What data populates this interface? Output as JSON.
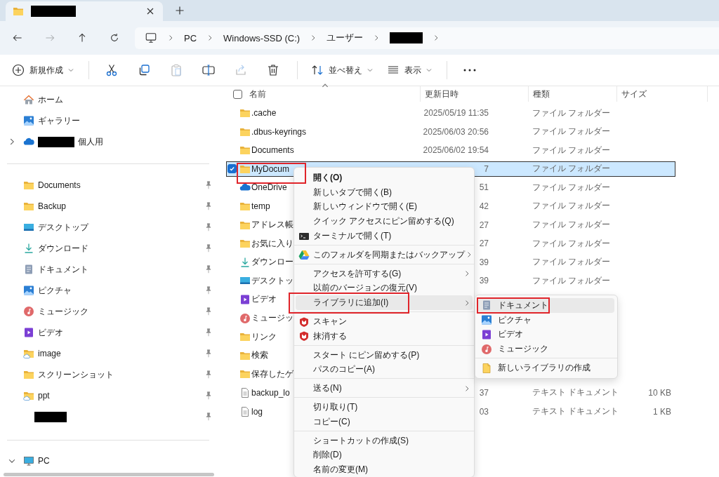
{
  "tabs": [
    {
      "redacted": true,
      "selected": true
    }
  ],
  "nav": [
    {
      "kind": "back",
      "disabled": false
    },
    {
      "kind": "forward",
      "disabled": true
    },
    {
      "kind": "up",
      "disabled": false
    },
    {
      "kind": "refresh",
      "disabled": false
    }
  ],
  "breadcrumb": [
    {
      "label": "PC"
    },
    {
      "label": "Windows-SSD (C:)"
    },
    {
      "label": "ユーザー"
    },
    {
      "redacted": true
    }
  ],
  "toolbar": [
    {
      "kind": "new",
      "label": "新規作成",
      "dropdown": true,
      "disabled": false
    },
    {
      "kind": "divider"
    },
    {
      "kind": "cut",
      "disabled": false
    },
    {
      "kind": "copy",
      "disabled": false
    },
    {
      "kind": "paste",
      "disabled": true
    },
    {
      "kind": "rename",
      "disabled": false
    },
    {
      "kind": "share",
      "disabled": true
    },
    {
      "kind": "delete",
      "disabled": false
    },
    {
      "kind": "divider"
    },
    {
      "kind": "sort",
      "label": "並べ替え",
      "dropdown": true,
      "disabled": false
    },
    {
      "kind": "view",
      "label": "表示",
      "dropdown": true,
      "disabled": false
    },
    {
      "kind": "divider"
    },
    {
      "kind": "more",
      "disabled": false
    }
  ],
  "sidebar": {
    "sections": [
      {
        "items": [
          {
            "kind": "home",
            "label": "ホーム"
          },
          {
            "kind": "gallery",
            "label": "ギャラリー"
          },
          {
            "kind": "cloud",
            "label": "個人用",
            "redacted_prefix": true,
            "expanded": false
          }
        ]
      },
      {
        "items": [
          {
            "kind": "folder",
            "label": "Documents",
            "pinned": true
          },
          {
            "kind": "folder",
            "label": "Backup",
            "pinned": true
          },
          {
            "kind": "desktop",
            "label": "デスクトップ",
            "pinned": true
          },
          {
            "kind": "download",
            "label": "ダウンロード",
            "pinned": true
          },
          {
            "kind": "documents",
            "label": "ドキュメント",
            "pinned": true
          },
          {
            "kind": "pictures",
            "label": "ピクチャ",
            "pinned": true
          },
          {
            "kind": "music",
            "label": "ミュージック",
            "pinned": true
          },
          {
            "kind": "video",
            "label": "ビデオ",
            "pinned": true
          },
          {
            "kind": "cloudfolder",
            "label": "image",
            "pinned": true
          },
          {
            "kind": "folder",
            "label": "スクリーンショット",
            "pinned": true
          },
          {
            "kind": "cloudfolder",
            "label": "ppt",
            "pinned": true
          },
          {
            "kind": "redacted",
            "pinned": true
          }
        ]
      },
      {
        "items": [
          {
            "kind": "pc",
            "label": "PC",
            "expanded": true
          }
        ]
      }
    ]
  },
  "list": {
    "select_all": {
      "checked": false
    },
    "columns": [
      {
        "label": "名前",
        "sorted": true
      },
      {
        "label": "更新日時"
      },
      {
        "label": "種類"
      },
      {
        "label": "サイズ"
      }
    ],
    "rows": [
      {
        "kind": "folder",
        "name": ".cache",
        "modified": "2025/05/19 11:35",
        "type": "ファイル フォルダー",
        "selected": false
      },
      {
        "kind": "folder",
        "name": ".dbus-keyrings",
        "modified": "2025/06/03 20:56",
        "type": "ファイル フォルダー",
        "selected": false
      },
      {
        "kind": "folder",
        "name": "Documents",
        "modified": "2025/06/02 19:54",
        "type": "ファイル フォルダー",
        "selected": false
      },
      {
        "kind": "folder",
        "name": "MyDocum",
        "modified": "7",
        "type": "ファイル フォルダー",
        "selected": true,
        "outlined": true
      },
      {
        "kind": "cloud",
        "name": "OneDrive",
        "modified": "51",
        "type": "ファイル フォルダー",
        "selected": false
      },
      {
        "kind": "folder",
        "name": "temp",
        "modified": "42",
        "type": "ファイル フォルダー",
        "selected": false
      },
      {
        "kind": "folder",
        "name": "アドレス帳",
        "modified": "27",
        "type": "ファイル フォルダー",
        "selected": false
      },
      {
        "kind": "folder",
        "name": "お気に入り",
        "modified": "27",
        "type": "ファイル フォルダー",
        "selected": false
      },
      {
        "kind": "download",
        "name": "ダウンロー",
        "modified": "39",
        "type": "ファイル フォルダー",
        "selected": false
      },
      {
        "kind": "desktop",
        "name": "デスクトッ",
        "modified": "39",
        "type": "ファイル フォルダー",
        "selected": false
      },
      {
        "kind": "video",
        "name": "ビデオ",
        "selected": false
      },
      {
        "kind": "music",
        "name": "ミュージッ",
        "selected": false
      },
      {
        "kind": "folder",
        "name": "リンク",
        "selected": false
      },
      {
        "kind": "folder",
        "name": "検索",
        "selected": false
      },
      {
        "kind": "folder",
        "name": "保存したゲ",
        "selected": false
      },
      {
        "kind": "file",
        "name": "backup_lo",
        "modified": "37",
        "type": "テキスト ドキュメント",
        "size": "10 KB",
        "selected": false
      },
      {
        "kind": "file",
        "name": "log",
        "modified": "03",
        "type": "テキスト ドキュメント",
        "size": "1 KB",
        "selected": false
      }
    ]
  },
  "context_menu": {
    "items": [
      {
        "kind": "plain",
        "label": "開く(O)",
        "default": true
      },
      {
        "kind": "plain",
        "label": "新しいタブで開く(B)"
      },
      {
        "kind": "plain",
        "label": "新しいウィンドウで開く(E)"
      },
      {
        "kind": "plain",
        "label": "クイック アクセスにピン留めする(Q)"
      },
      {
        "kind": "terminal",
        "label": "ターミナルで開く(T)"
      },
      {
        "kind": "separator"
      },
      {
        "kind": "drive",
        "label": "このフォルダを同期またはバックアップ",
        "submenu": true
      },
      {
        "kind": "separator"
      },
      {
        "kind": "plain",
        "label": "アクセスを許可する(G)",
        "submenu": true
      },
      {
        "kind": "plain",
        "label": "以前のバージョンの復元(V)"
      },
      {
        "kind": "plain",
        "label": "ライブラリに追加(I)",
        "submenu": true,
        "hovered": true,
        "outlined": true
      },
      {
        "kind": "separator"
      },
      {
        "kind": "shield",
        "label": "スキャン"
      },
      {
        "kind": "shield",
        "label": "抹消する"
      },
      {
        "kind": "separator"
      },
      {
        "kind": "plain",
        "label": "スタート にピン留めする(P)"
      },
      {
        "kind": "plain",
        "label": "パスのコピー(A)"
      },
      {
        "kind": "separator"
      },
      {
        "kind": "plain",
        "label": "送る(N)",
        "submenu": true
      },
      {
        "kind": "separator"
      },
      {
        "kind": "plain",
        "label": "切り取り(T)"
      },
      {
        "kind": "plain",
        "label": "コピー(C)"
      },
      {
        "kind": "separator"
      },
      {
        "kind": "plain",
        "label": "ショートカットの作成(S)"
      },
      {
        "kind": "plain",
        "label": "削除(D)"
      },
      {
        "kind": "plain",
        "label": "名前の変更(M)"
      }
    ]
  },
  "submenu": {
    "items": [
      {
        "kind": "documents",
        "label": "ドキュメント",
        "hovered": true,
        "outlined": true
      },
      {
        "kind": "pictures",
        "label": "ピクチャ"
      },
      {
        "kind": "video",
        "label": "ビデオ"
      },
      {
        "kind": "music",
        "label": "ミュージック"
      },
      {
        "kind": "separator"
      },
      {
        "kind": "newlibrary",
        "label": "新しいライブラリの作成"
      }
    ]
  }
}
